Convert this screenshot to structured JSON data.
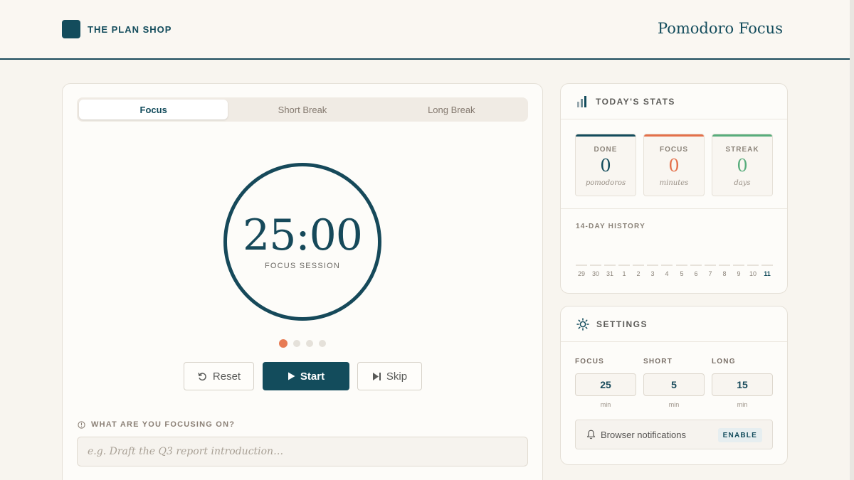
{
  "header": {
    "brand": "THE PLAN SHOP",
    "title": "Pomodoro Focus"
  },
  "timer": {
    "tabs": [
      {
        "label": "Focus",
        "active": true
      },
      {
        "label": "Short Break",
        "active": false
      },
      {
        "label": "Long Break",
        "active": false
      }
    ],
    "time": "25:00",
    "session_label": "FOCUS SESSION",
    "cycle_dots": {
      "completed": 1,
      "total": 4
    },
    "buttons": {
      "reset": "Reset",
      "start": "Start",
      "skip": "Skip"
    },
    "focus_prompt": "WHAT ARE YOU FOCUSING ON?",
    "focus_input": {
      "value": "",
      "placeholder": "e.g. Draft the Q3 report introduction…"
    }
  },
  "stats": {
    "title": "TODAY'S STATS",
    "boxes": [
      {
        "label": "DONE",
        "value": "0",
        "unit": "pomodoros",
        "color": "#134c5c"
      },
      {
        "label": "FOCUS",
        "value": "0",
        "unit": "minutes",
        "color": "#e4704a"
      },
      {
        "label": "STREAK",
        "value": "0",
        "unit": "days",
        "color": "#58ad7c"
      }
    ],
    "history_title": "14-DAY HISTORY",
    "history": [
      {
        "day": "29",
        "count": 0
      },
      {
        "day": "30",
        "count": 0
      },
      {
        "day": "31",
        "count": 0
      },
      {
        "day": "1",
        "count": 0
      },
      {
        "day": "2",
        "count": 0
      },
      {
        "day": "3",
        "count": 0
      },
      {
        "day": "4",
        "count": 0
      },
      {
        "day": "5",
        "count": 0
      },
      {
        "day": "6",
        "count": 0
      },
      {
        "day": "7",
        "count": 0
      },
      {
        "day": "8",
        "count": 0
      },
      {
        "day": "9",
        "count": 0
      },
      {
        "day": "10",
        "count": 0
      },
      {
        "day": "11",
        "count": 0,
        "today": true
      }
    ]
  },
  "settings": {
    "title": "SETTINGS",
    "fields": [
      {
        "label": "FOCUS",
        "value": "25",
        "unit": "min"
      },
      {
        "label": "SHORT",
        "value": "5",
        "unit": "min"
      },
      {
        "label": "LONG",
        "value": "15",
        "unit": "min"
      }
    ],
    "notifications": {
      "label": "Browser notifications",
      "button": "ENABLE"
    }
  },
  "colors": {
    "primary": "#134c5c",
    "accent": "#e77b54",
    "success": "#58ad7c",
    "background": "#f8f5ef"
  },
  "icons": {
    "reset": "reset-icon",
    "start": "play-icon",
    "skip": "skip-icon",
    "focus_prompt": "info-icon",
    "stats": "bar-chart-icon",
    "settings": "sun-icon",
    "notify": "bell-icon"
  }
}
